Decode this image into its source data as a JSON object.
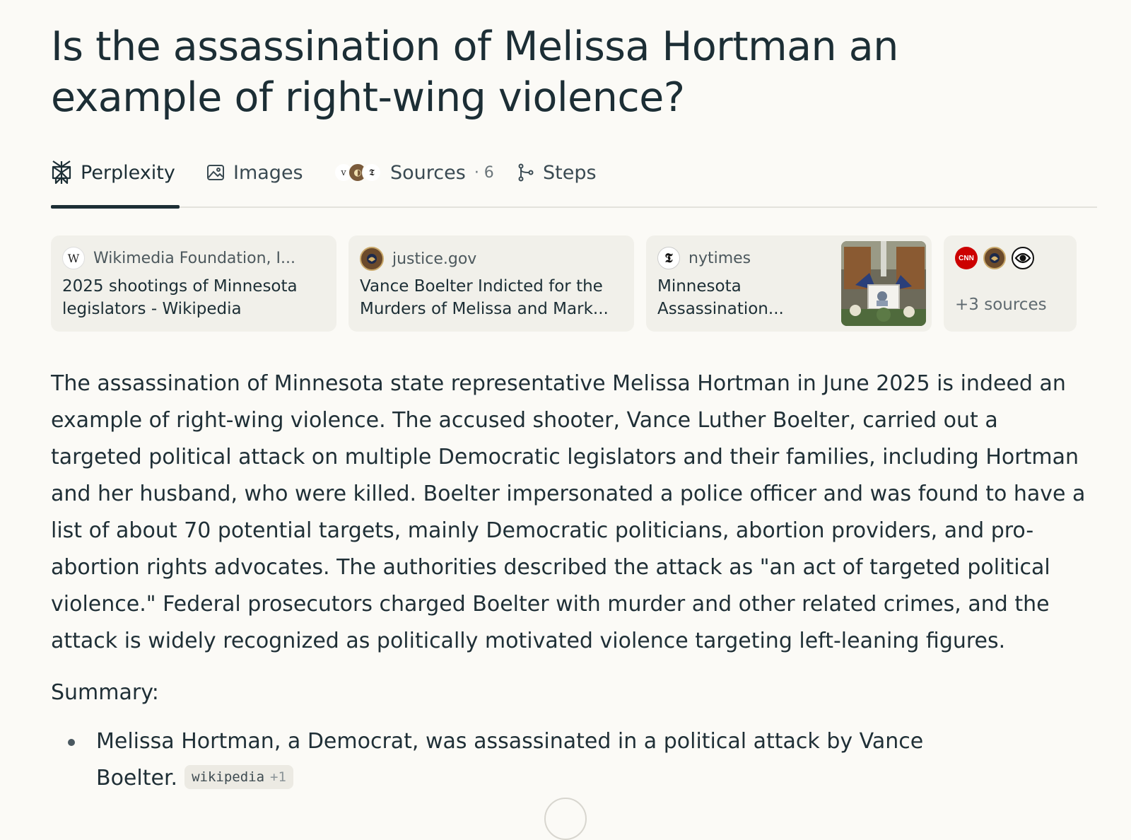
{
  "question": "Is the assassination of Melissa Hortman an example of right-wing violence?",
  "tabs": {
    "perplexity": "Perplexity",
    "images": "Images",
    "sources": "Sources",
    "sources_count": "· 6",
    "steps": "Steps",
    "active": "perplexity"
  },
  "source_cards": [
    {
      "source": "Wikimedia Foundation, I...",
      "title_line1": "2025 shootings of Minnesota",
      "title_line2": "legislators - Wikipedia",
      "icon": "wikipedia-icon"
    },
    {
      "source": "justice.gov",
      "title_line1": "Vance Boelter Indicted for the",
      "title_line2": "Murders of Melissa and Mark...",
      "icon": "doj-seal-icon"
    },
    {
      "source": "nytimes",
      "title_line1": "Minnesota",
      "title_line2": "Assassination...",
      "icon": "nyt-icon",
      "has_thumbnail": true
    }
  ],
  "more_sources": {
    "label": "+3 sources",
    "icons": [
      "cnn-icon",
      "doj-seal-icon",
      "cbs-eye-icon"
    ]
  },
  "answer_paragraph": "The assassination of Minnesota state representative Melissa Hortman in June 2025 is indeed an example of right-wing violence. The accused shooter, Vance Luther Boelter, carried out a targeted political attack on multiple Democratic legislators and their families, including Hortman and her husband, who were killed. Boelter impersonated a police officer and was found to have a list of about 70 potential targets, mainly Democratic politicians, abortion providers, and pro-abortion rights advocates. The authorities described the attack as \"an act of targeted political violence.\" Federal prosecutors charged Boelter with murder and other related crimes, and the attack is widely recognized as politically motivated violence targeting left-leaning figures.",
  "summary_label": "Summary:",
  "bullets": [
    {
      "text": "Melissa Hortman, a Democrat, was assassinated in a political attack by Vance Boelter.",
      "citation": "wikipedia",
      "citation_extra": "+1"
    }
  ],
  "colors": {
    "background": "#fbfaf6",
    "text": "#1f2f36",
    "card": "#f1f0ea",
    "accent": "#1c2e35",
    "cnn_red": "#cc0000"
  }
}
